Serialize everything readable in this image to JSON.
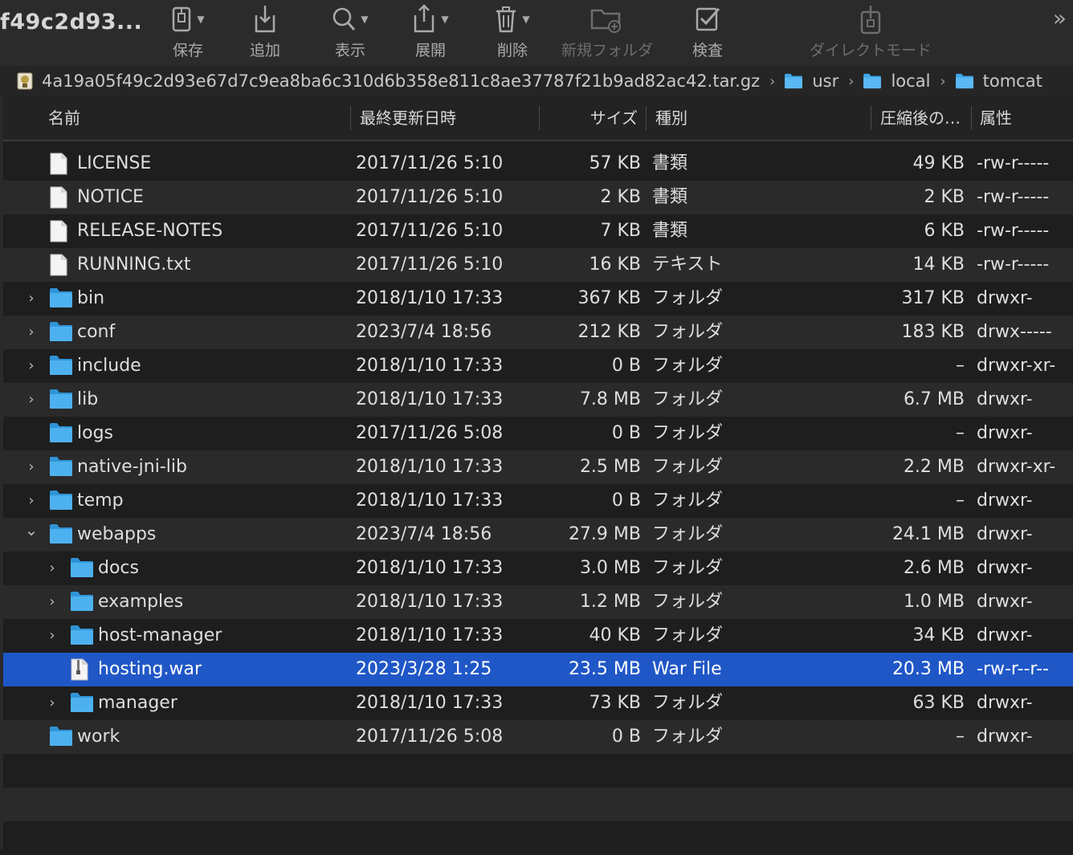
{
  "window": {
    "title": "f49c2d93..."
  },
  "toolbar": {
    "save": "保存",
    "add": "追加",
    "view": "表示",
    "extract": "展開",
    "delete": "削除",
    "new_folder": "新規フォルダ",
    "inspect": "検査",
    "direct_mode": "ダイレクトモード",
    "more": "»"
  },
  "path": {
    "archive": "4a19a05f49c2d93e67d7c9ea8ba6c310d6b358e811c8ae37787f21b9ad82ac42.tar.gz",
    "seg1": "usr",
    "seg2": "local",
    "seg3": "tomcat",
    "separator": "›"
  },
  "columns": {
    "name": "名前",
    "date": "最終更新日時",
    "size": "サイズ",
    "kind": "種別",
    "compressed": "圧縮後の…",
    "attributes": "属性"
  },
  "rows": [
    {
      "name": "LICENSE",
      "date": "2017/11/26 5:10",
      "size": "57 KB",
      "kind": "書類",
      "csize": "49 KB",
      "attr": "-rw-r-----",
      "type": "doc",
      "disclosure": ""
    },
    {
      "name": "NOTICE",
      "date": "2017/11/26 5:10",
      "size": "2 KB",
      "kind": "書類",
      "csize": "2 KB",
      "attr": "-rw-r-----",
      "type": "doc",
      "disclosure": ""
    },
    {
      "name": "RELEASE-NOTES",
      "date": "2017/11/26 5:10",
      "size": "7 KB",
      "kind": "書類",
      "csize": "6 KB",
      "attr": "-rw-r-----",
      "type": "doc",
      "disclosure": ""
    },
    {
      "name": "RUNNING.txt",
      "date": "2017/11/26 5:10",
      "size": "16 KB",
      "kind": "テキスト",
      "csize": "14 KB",
      "attr": "-rw-r-----",
      "type": "txt",
      "disclosure": ""
    },
    {
      "name": "bin",
      "date": "2018/1/10 17:33",
      "size": "367 KB",
      "kind": "フォルダ",
      "csize": "317 KB",
      "attr": "drwxr-",
      "type": "folder",
      "disclosure": "›"
    },
    {
      "name": "conf",
      "date": "2023/7/4 18:56",
      "size": "212 KB",
      "kind": "フォルダ",
      "csize": "183 KB",
      "attr": "drwx-----",
      "type": "folder",
      "disclosure": "›"
    },
    {
      "name": "include",
      "date": "2018/1/10 17:33",
      "size": "0 B",
      "kind": "フォルダ",
      "csize": "–",
      "attr": "drwxr-xr-",
      "type": "folder",
      "disclosure": "›"
    },
    {
      "name": "lib",
      "date": "2018/1/10 17:33",
      "size": "7.8 MB",
      "kind": "フォルダ",
      "csize": "6.7 MB",
      "attr": "drwxr-",
      "type": "folder",
      "disclosure": "›"
    },
    {
      "name": "logs",
      "date": "2017/11/26 5:08",
      "size": "0 B",
      "kind": "フォルダ",
      "csize": "–",
      "attr": "drwxr-",
      "type": "folder",
      "disclosure": ""
    },
    {
      "name": "native-jni-lib",
      "date": "2018/1/10 17:33",
      "size": "2.5 MB",
      "kind": "フォルダ",
      "csize": "2.2 MB",
      "attr": "drwxr-xr-",
      "type": "folder",
      "disclosure": "›"
    },
    {
      "name": "temp",
      "date": "2018/1/10 17:33",
      "size": "0 B",
      "kind": "フォルダ",
      "csize": "–",
      "attr": "drwxr-",
      "type": "folder",
      "disclosure": "›"
    },
    {
      "name": "webapps",
      "date": "2023/7/4 18:56",
      "size": "27.9 MB",
      "kind": "フォルダ",
      "csize": "24.1 MB",
      "attr": "drwxr-",
      "type": "folder",
      "disclosure": "⌄"
    },
    {
      "name": "docs",
      "date": "2018/1/10 17:33",
      "size": "3.0 MB",
      "kind": "フォルダ",
      "csize": "2.6 MB",
      "attr": "drwxr-",
      "type": "folder",
      "disclosure": "›",
      "indent": true
    },
    {
      "name": "examples",
      "date": "2018/1/10 17:33",
      "size": "1.2 MB",
      "kind": "フォルダ",
      "csize": "1.0 MB",
      "attr": "drwxr-",
      "type": "folder",
      "disclosure": "›",
      "indent": true
    },
    {
      "name": "host-manager",
      "date": "2018/1/10 17:33",
      "size": "40 KB",
      "kind": "フォルダ",
      "csize": "34 KB",
      "attr": "drwxr-",
      "type": "folder",
      "disclosure": "›",
      "indent": true
    },
    {
      "name": "hosting.war",
      "date": "2023/3/28 1:25",
      "size": "23.5 MB",
      "kind": "War File",
      "csize": "20.3 MB",
      "attr": "-rw-r--r--",
      "type": "war",
      "disclosure": "",
      "indent": true,
      "selected": true
    },
    {
      "name": "manager",
      "date": "2018/1/10 17:33",
      "size": "73 KB",
      "kind": "フォルダ",
      "csize": "63 KB",
      "attr": "drwxr-",
      "type": "folder",
      "disclosure": "›",
      "indent": true
    },
    {
      "name": "work",
      "date": "2017/11/26 5:08",
      "size": "0 B",
      "kind": "フォルダ",
      "csize": "–",
      "attr": "drwxr-",
      "type": "folder",
      "disclosure": ""
    }
  ],
  "colors": {
    "selection": "#2057c7",
    "folder": "#3ea6e8",
    "background": "#1e1e1e",
    "row_alt": "#2a2a2a"
  }
}
